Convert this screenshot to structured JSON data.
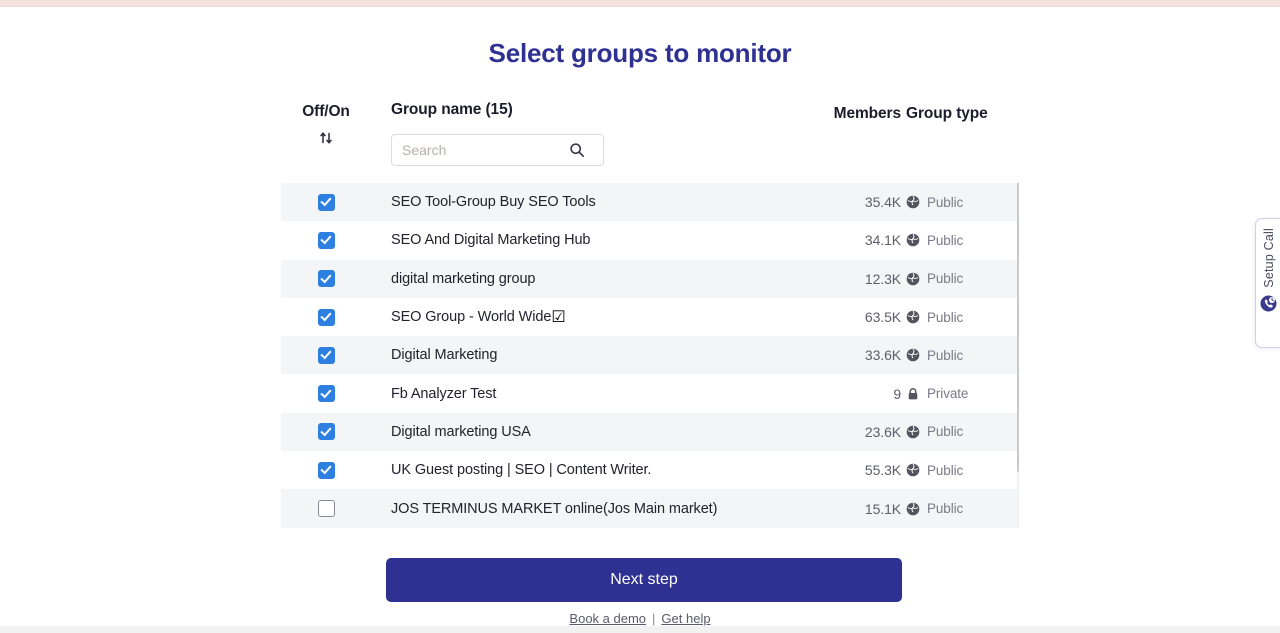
{
  "page": {
    "title": "Select groups to monitor"
  },
  "table": {
    "headers": {
      "off_on": "Off/On",
      "group_name": "Group name (15)",
      "members": "Members",
      "group_type": "Group type"
    },
    "sort_icon": "sort-updown-icon",
    "search": {
      "placeholder": "Search",
      "value": "",
      "icon": "search-icon"
    },
    "rows": [
      {
        "checked": true,
        "name": "SEO Tool-Group Buy SEO Tools",
        "name_suffix": "",
        "members": "35.4K",
        "type": "Public",
        "type_icon": "globe-icon"
      },
      {
        "checked": true,
        "name": "SEO And Digital Marketing Hub",
        "name_suffix": "",
        "members": "34.1K",
        "type": "Public",
        "type_icon": "globe-icon"
      },
      {
        "checked": true,
        "name": "digital marketing group",
        "name_suffix": "",
        "members": "12.3K",
        "type": "Public",
        "type_icon": "globe-icon"
      },
      {
        "checked": true,
        "name": "SEO Group - World Wide",
        "name_suffix": "☑",
        "members": "63.5K",
        "type": "Public",
        "type_icon": "globe-icon"
      },
      {
        "checked": true,
        "name": "Digital Marketing",
        "name_suffix": "",
        "members": "33.6K",
        "type": "Public",
        "type_icon": "globe-icon"
      },
      {
        "checked": true,
        "name": "Fb Analyzer Test",
        "name_suffix": "",
        "members": "9",
        "type": "Private",
        "type_icon": "lock-icon"
      },
      {
        "checked": true,
        "name": "Digital marketing USA",
        "name_suffix": "",
        "members": "23.6K",
        "type": "Public",
        "type_icon": "globe-icon"
      },
      {
        "checked": true,
        "name": "UK Guest posting | SEO | Content Writer.",
        "name_suffix": "",
        "members": "55.3K",
        "type": "Public",
        "type_icon": "globe-icon"
      },
      {
        "checked": false,
        "name": "JOS TERMINUS MARKET online(Jos Main market)",
        "name_suffix": "",
        "members": "15.1K",
        "type": "Public",
        "type_icon": "globe-icon"
      }
    ]
  },
  "footer": {
    "next_step": "Next step",
    "book_demo": "Book a demo",
    "separator": "|",
    "get_help": "Get help"
  },
  "setup_call": {
    "label": "Setup Call",
    "icon": "phone-clock-icon"
  },
  "colors": {
    "brand_indigo": "#2e3192",
    "checkbox_blue": "#2e80e0",
    "row_stripe": "#f4f5f7",
    "top_strip": "#f4e3dc"
  }
}
